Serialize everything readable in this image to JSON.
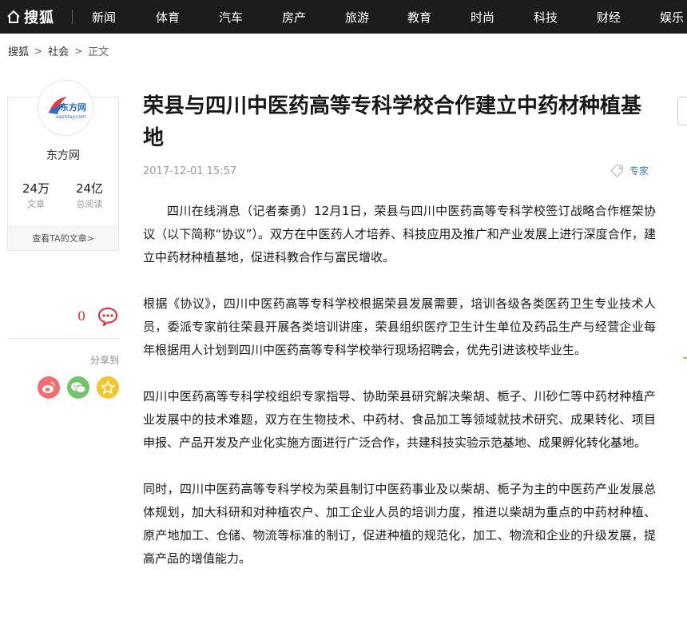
{
  "header": {
    "brand": "搜狐",
    "nav": [
      "新闻",
      "体育",
      "汽车",
      "房产",
      "旅游",
      "教育",
      "时尚",
      "科技",
      "财经",
      "娱乐"
    ]
  },
  "breadcrumb": {
    "items": [
      "搜狐",
      "社会",
      "正文"
    ]
  },
  "author": {
    "name": "东方网",
    "logo_text": "东方网",
    "logo_sub": "eastday.com",
    "articles_count": "24万",
    "articles_label": "文章",
    "reads_count": "24亿",
    "reads_label": "总阅读",
    "view_link": "查看TA的文章>"
  },
  "interaction": {
    "comment_count": "0",
    "share_label": "分享到"
  },
  "article": {
    "title": "荣县与四川中医药高等专科学校合作建立中药材种植基地",
    "date": "2017-12-01 15:57",
    "tag": "专家",
    "paragraphs": [
      "四川在线消息（记者秦勇）12月1日，荣县与四川中医药高等专科学校签订战略合作框架协议（以下简称“协议”）。双方在中医药人才培养、科技应用及推广和产业发展上进行深度合作，建立中药材种植基地，促进科教合作与富民增收。",
      "根据《协议》，四川中医药高等专科学校根据荣县发展需要，培训各级各类医药卫生专业技术人员，委派专家前往荣县开展各类培训讲座，荣县组织医疗卫生计生单位及药品生产与经营企业每年根据用人计划到四川中医药高等专科学校举行现场招聘会，优先引进该校毕业生。",
      "四川中医药高等专科学校组织专家指导、协助荣县研究解决柴胡、栀子、川砂仁等中药材种植产业发展中的技术难题，双方在生物技术、中药材、食品加工等领域就技术研究、成果转化、项目申报、产品开发及产业化实施方面进行广泛合作，共建科技实验示范基地、成果孵化转化基地。",
      "同时，四川中医药高等专科学校为荣县制订中医药事业及以柴胡、栀子为主的中医药产业发展总体规划，加大科研和对种植农户、加工企业人员的培训力度，推进以柴胡为重点的中药材种植、原产地加工、仓储、物流等标准的制订，促进种植的规范化，加工、物流和企业的升级发展，提高产品的增值能力。"
    ]
  }
}
